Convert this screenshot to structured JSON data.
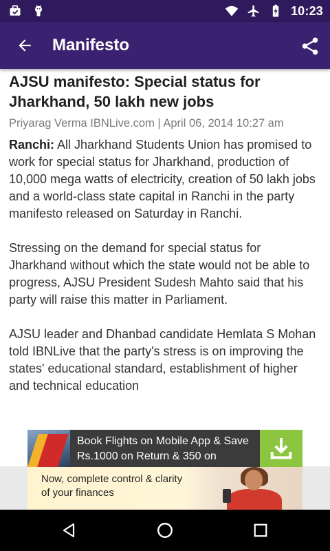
{
  "status_bar": {
    "time": "10:23",
    "left_icons": [
      "briefcase-check-icon",
      "android-icon"
    ],
    "right_icons": [
      "wifi-icon",
      "airplane-icon",
      "battery-charging-icon"
    ]
  },
  "app_bar": {
    "title": "Manifesto",
    "back_icon": "arrow-back-icon",
    "share_icon": "share-icon",
    "color": "#3a2270"
  },
  "article": {
    "headline": "AJSU manifesto: Special status for Jharkhand, 50 lakh new jobs",
    "byline": "Priyarag Verma IBNLive.com | April 06, 2014 10:27 am",
    "place": "Ranchi:",
    "paragraph1_rest": " All Jharkhand Students Union has promised to work for special status for Jharkhand, production of 10,000 mega watts of electricity, creation of 50 lakh jobs and a world-class state capital in Ranchi in the party manifesto released on Saturday in Ranchi.",
    "paragraph2": "Stressing on the demand for special status for Jharkhand without which the state would not be able to progress, AJSU President Sudesh Mahto said that his party will raise this matter in Parliament.",
    "paragraph3": "AJSU leader and Dhanbad candidate Hemlata S Mohan told IBNLive that the party's stress is on improving the states' educational standard, establishment of higher and technical education"
  },
  "ads": {
    "top_text": "Book Flights on Mobile App & Save Rs.1000 on Return & 350 on",
    "bottom_text": "Now, complete control & clarity of your finances"
  },
  "nav_bar": {
    "icons": [
      "back-triangle-icon",
      "home-circle-icon",
      "recents-square-icon"
    ]
  }
}
